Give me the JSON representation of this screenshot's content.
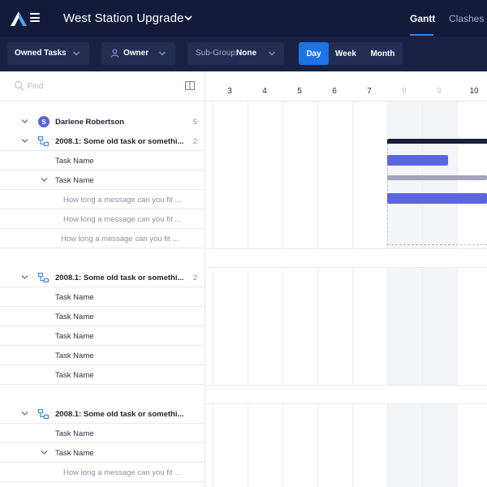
{
  "app": {
    "project_title": "West Station Upgrade",
    "tabs": [
      {
        "label": "Gantt",
        "active": true
      },
      {
        "label": "Clashes",
        "active": false
      }
    ]
  },
  "toolbar": {
    "filter_label": "Owned Tasks",
    "owner_label": "Owner",
    "subgroup_prefix": "Sub-Group:",
    "subgroup_value": "None",
    "zoom_options": [
      "Day",
      "Week",
      "Month"
    ],
    "zoom_selected": "Day"
  },
  "search": {
    "placeholder": "Find",
    "value": ""
  },
  "timeline": {
    "days": [
      "3",
      "4",
      "5",
      "6",
      "7",
      "8",
      "9",
      "10"
    ],
    "weekend_days": [
      "8",
      "9"
    ]
  },
  "tree": {
    "user": {
      "initial": "S",
      "name": "Darlene Robertson",
      "count": "5"
    },
    "groups": [
      {
        "title": "2008.1: Some old task or somethi...",
        "count": "2",
        "rows": [
          {
            "type": "task",
            "label": "Task Name"
          },
          {
            "type": "task-expandable",
            "label": "Task Name"
          },
          {
            "type": "message",
            "label": "How long a message can you fit ..."
          },
          {
            "type": "message",
            "label": "How long a message can you fit ..."
          },
          {
            "type": "message",
            "label": "How long a message can you fit ..."
          }
        ]
      },
      {
        "title": "2008.1: Some old task or somethi...",
        "count": "2",
        "rows": [
          {
            "type": "task",
            "label": "Task Name"
          },
          {
            "type": "task",
            "label": "Task Name"
          },
          {
            "type": "task",
            "label": "Task Name"
          },
          {
            "type": "task",
            "label": "Task Name"
          },
          {
            "type": "task",
            "label": "Task Name"
          }
        ]
      },
      {
        "title": "2008.1: Some old task or somethi...",
        "count": "",
        "rows": [
          {
            "type": "task",
            "label": "Task Name"
          },
          {
            "type": "task-expandable",
            "label": "Task Name"
          },
          {
            "type": "message",
            "label": "How long a message can you fit ..."
          }
        ]
      }
    ]
  },
  "colors": {
    "topbar": "#131a3a",
    "toolbar": "#1a2244",
    "accent": "#1e73e6",
    "bar_primary": "#5a66e0",
    "bar_parent": "#1a1f3d",
    "bar_grey": "#a2a5b8"
  },
  "icons": {
    "logo": "brand-logo-icon",
    "menu": "hamburger-icon",
    "search": "search-icon",
    "columns": "columns-icon",
    "group": "hierarchy-icon",
    "collapse": "chevron-down-icon"
  }
}
